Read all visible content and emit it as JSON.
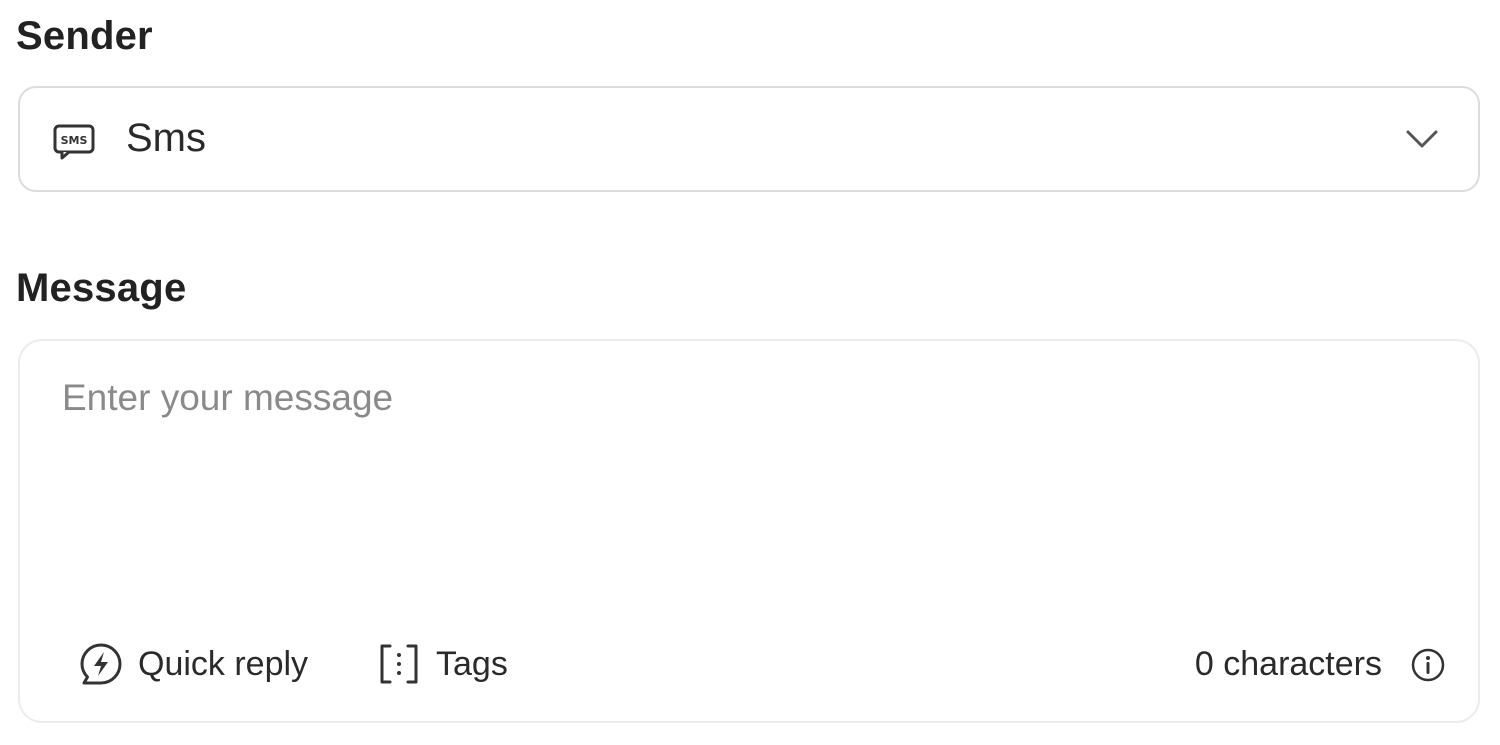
{
  "sender": {
    "label": "Sender",
    "selected_value": "Sms",
    "icon": "sms-icon",
    "dropdown_icon": "chevron-down-icon"
  },
  "message": {
    "label": "Message",
    "placeholder": "Enter your message",
    "value": "",
    "toolbar": {
      "quick_reply_label": "Quick reply",
      "quick_reply_icon": "lightning-chat-icon",
      "tags_label": "Tags",
      "tags_icon": "bracket-tags-icon"
    },
    "character_count": "0 characters",
    "info_icon": "info-icon"
  }
}
